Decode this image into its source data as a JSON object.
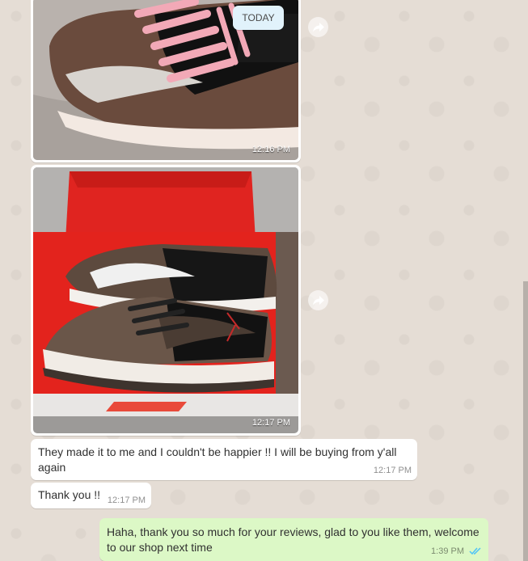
{
  "chat": {
    "date_badge": "TODAY",
    "messages": [
      {
        "type": "image",
        "time": "12:16 PM",
        "description": "pink-laced brown and black sneaker on a bed"
      },
      {
        "type": "image",
        "time": "12:17 PM",
        "description": "two brown and black sneakers in a red shoe box"
      },
      {
        "type": "text",
        "direction": "incoming",
        "text": "They made it to me and I couldn't be happier !! I will be buying from y'all again",
        "time": "12:17 PM"
      },
      {
        "type": "text",
        "direction": "incoming",
        "text": "Thank you !!",
        "time": "12:17 PM"
      },
      {
        "type": "text",
        "direction": "outgoing",
        "text": "Haha, thank you so much for your reviews, glad to you like them, welcome to our shop next time",
        "time": "1:39 PM",
        "status": "read"
      }
    ]
  },
  "icons": {
    "forward": "forward-icon",
    "read_receipt": "double-check-icon"
  },
  "colors": {
    "background": "#e5ddd5",
    "incoming_bubble": "#ffffff",
    "outgoing_bubble": "#dcf8c6",
    "read_tick": "#4fc3f7",
    "date_badge": "#e1f2fb"
  }
}
